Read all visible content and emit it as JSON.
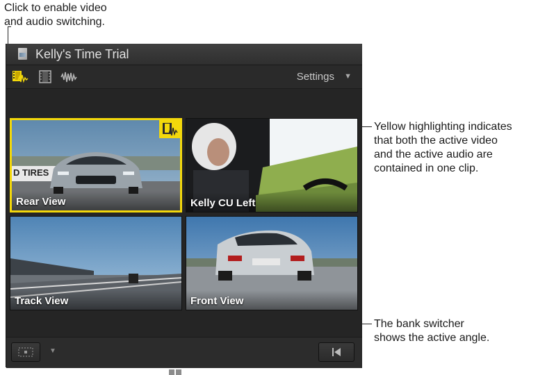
{
  "callouts": {
    "top_line1": "Click to enable video",
    "top_line2": "and audio switching.",
    "right_line1": "Yellow highlighting indicates",
    "right_line2": "that both the active video",
    "right_line3": "and the active audio are",
    "right_line4": "contained in one clip.",
    "bottom_line1": "The bank switcher",
    "bottom_line2": "shows the active angle."
  },
  "viewer": {
    "title": "Kelly's Time Trial",
    "settings_label": "Settings",
    "toolbar_icons": [
      "video-and-audio-switch-icon",
      "video-only-switch-icon",
      "audio-only-switch-icon"
    ],
    "angles": [
      {
        "label": "Rear View",
        "active": true
      },
      {
        "label": "Kelly CU Left",
        "active": false
      },
      {
        "label": "Track View",
        "active": false
      },
      {
        "label": "Front View",
        "active": false
      }
    ]
  },
  "colors": {
    "highlight": "#f3d80b",
    "background": "#252525"
  }
}
